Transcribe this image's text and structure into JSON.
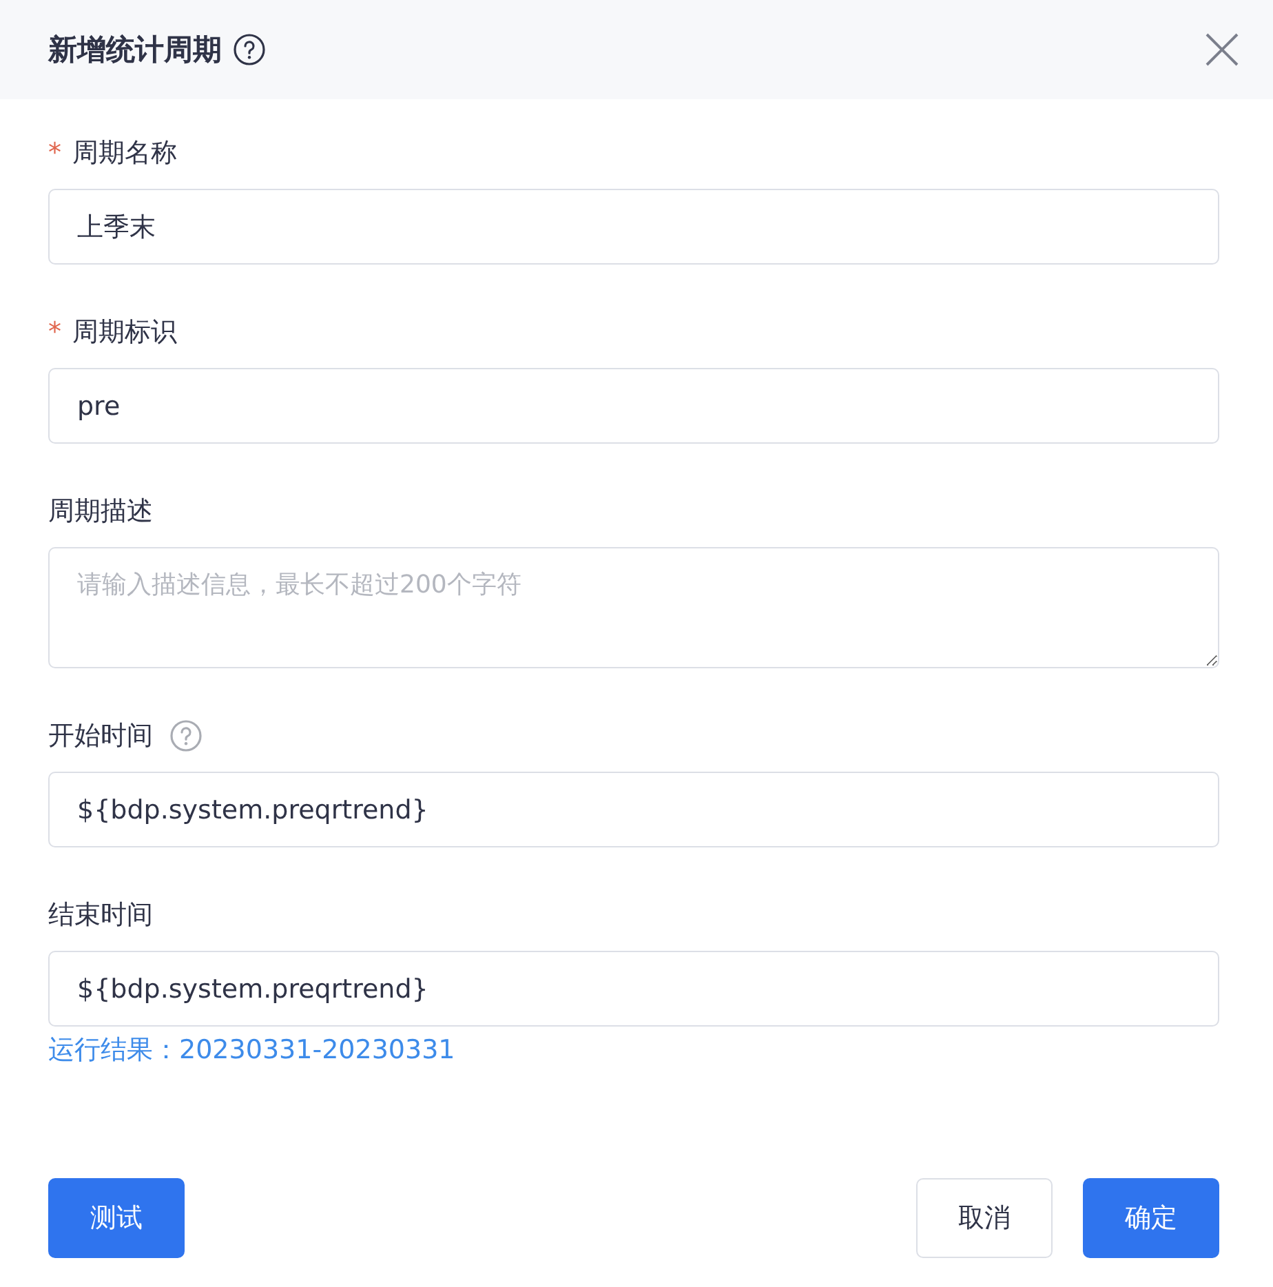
{
  "dialog": {
    "title": "新增统计周期",
    "help": true
  },
  "fields": [
    {
      "kind": "input",
      "label": "周期名称",
      "required": true,
      "help": false,
      "value": "上季末"
    },
    {
      "kind": "input",
      "label": "周期标识",
      "required": true,
      "help": false,
      "value": "pre"
    },
    {
      "kind": "textarea",
      "label": "周期描述",
      "required": false,
      "help": false,
      "placeholder": "请输入描述信息，最长不超过200个字符"
    },
    {
      "kind": "input",
      "label": "开始时间",
      "required": false,
      "help": true,
      "value": "${bdp.system.preqrtrend}"
    },
    {
      "kind": "input",
      "label": "结束时间",
      "required": false,
      "help": false,
      "value": "${bdp.system.preqrtrend}",
      "result": "运行结果：20230331-20230331"
    }
  ],
  "required_mark": "*",
  "buttons": [
    {
      "label": "测试",
      "kind": "primary"
    },
    {
      "label": "取消",
      "kind": "default"
    },
    {
      "label": "确定",
      "kind": "primary"
    }
  ]
}
